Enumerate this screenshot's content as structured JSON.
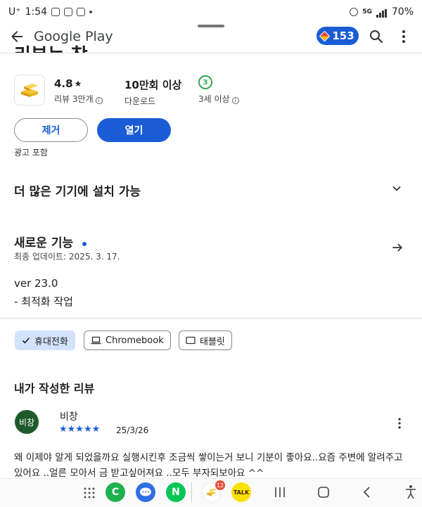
{
  "status_bar": {
    "carrier": "U⁺",
    "time": "1:54",
    "battery": "70%",
    "network_label": "5G"
  },
  "topbar": {
    "app_name": "Google Play",
    "points": "153"
  },
  "app": {
    "cut_title": "리뷰는 창",
    "rating": "4.8",
    "rating_star": "★",
    "reviews": "리뷰 3만개",
    "downloads": "10만회 이상",
    "downloads_label": "다운로드",
    "age_number": "3",
    "age_label": "3세 이상",
    "remove_label": "제거",
    "open_label": "열기",
    "ads_note": "광고 포함"
  },
  "sections": {
    "more_devices": "더 많은 기기에 설치 가능",
    "whats_new": "새로운 기능",
    "last_updated": "최종 업데이트: 2025. 3. 17.",
    "version": "ver 23.0",
    "version_note": "- 최적화 작업"
  },
  "device_chips": [
    {
      "label": "휴대전화",
      "selected": true
    },
    {
      "label": "Chromebook",
      "selected": false
    },
    {
      "label": "태블릿",
      "selected": false
    }
  ],
  "my_review": {
    "heading": "내가 작성한 리뷰",
    "avatar_text": "비창",
    "name": "비창",
    "stars": "★★★★★",
    "rating": 5,
    "date": "25/3/26",
    "text": "왜 이제야 알게 되었을까요 실행시킨후 조금씩 쌓이는거 보니 기분이 좋아요..요즘 주변에 알려주고있어요 ..얼른 모아서 금 받고싶어져요 ..모두 부자되보아요 ^^"
  },
  "navbar": {
    "badge_count": "12",
    "app_letters": [
      "C",
      "N"
    ],
    "talk_label": "TALK"
  },
  "colors": {
    "accent": "#1a5cd6",
    "chip_selected": "#d3e3fd",
    "avatar": "#1e5b2c",
    "age_green": "#34a853"
  }
}
